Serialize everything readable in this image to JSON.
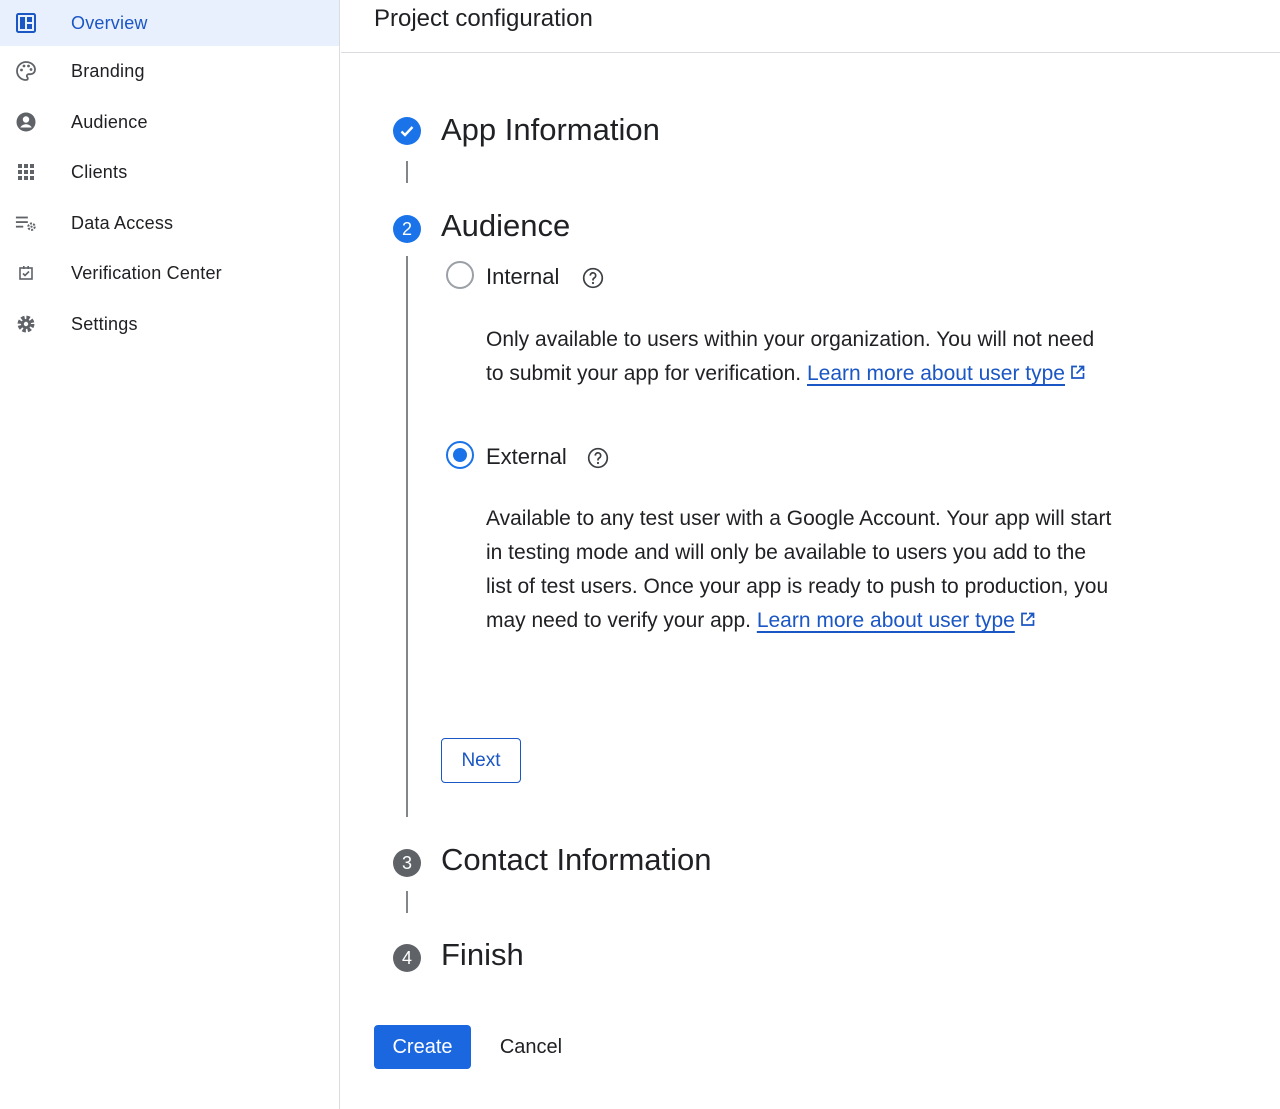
{
  "sidebar": {
    "items": [
      {
        "label": "Overview",
        "icon": "dashboard-icon",
        "active": true
      },
      {
        "label": "Branding",
        "icon": "palette-icon"
      },
      {
        "label": "Audience",
        "icon": "account-circle-icon"
      },
      {
        "label": "Clients",
        "icon": "apps-grid-icon"
      },
      {
        "label": "Data Access",
        "icon": "list-settings-icon"
      },
      {
        "label": "Verification Center",
        "icon": "checkbox-icon"
      },
      {
        "label": "Settings",
        "icon": "gear-icon"
      }
    ]
  },
  "header": {
    "title": "Project configuration"
  },
  "steps": [
    {
      "number": "1",
      "title": "App Information",
      "state": "done"
    },
    {
      "number": "2",
      "title": "Audience",
      "state": "current"
    },
    {
      "number": "3",
      "title": "Contact Information",
      "state": "pending"
    },
    {
      "number": "4",
      "title": "Finish",
      "state": "pending"
    }
  ],
  "audience": {
    "internal": {
      "label": "Internal",
      "selected": false,
      "description": "Only available to users within your organization. You will not need to submit your app for verification.",
      "link_text": "Learn more about user type"
    },
    "external": {
      "label": "External",
      "selected": true,
      "description": "Available to any test user with a Google Account. Your app will start in testing mode and will only be available to users you add to the list of test users. Once your app is ready to push to production, you may need to verify your app.",
      "link_text": "Learn more about user type"
    },
    "next_label": "Next"
  },
  "actions": {
    "create_label": "Create",
    "cancel_label": "Cancel"
  },
  "colors": {
    "accent": "#1a73e8",
    "link": "#1a56c4",
    "active_nav_bg": "#e8f0fe",
    "pending_step": "#5f6368"
  }
}
